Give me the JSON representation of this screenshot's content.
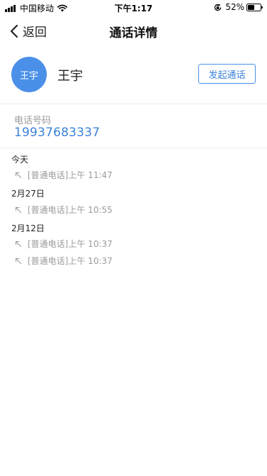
{
  "status_bar": {
    "carrier": "中国移动",
    "time": "下午1:17",
    "battery_percent": "52%",
    "battery_level": 0.52,
    "icons": [
      "signal-icon",
      "wifi-icon",
      "rotation-lock-icon",
      "battery-icon"
    ]
  },
  "nav": {
    "back_label": "返回",
    "title": "通话详情"
  },
  "contact": {
    "avatar_text": "王宇",
    "name": "王宇",
    "call_button_label": "发起通话",
    "avatar_color": "#4a90e8"
  },
  "phone": {
    "label": "电话号码",
    "number": "19937683337"
  },
  "call_log": [
    {
      "date": "今天",
      "records": [
        "[普通电话]上午 11:47"
      ]
    },
    {
      "date": "2月27日",
      "records": [
        "[普通电话]上午 10:55"
      ]
    },
    {
      "date": "2月12日",
      "records": [
        "[普通电话]上午 10:37",
        "[普通电话]上午 10:37"
      ]
    }
  ],
  "colors": {
    "accent": "#3b82d9",
    "muted_text": "#9b9b9b"
  }
}
